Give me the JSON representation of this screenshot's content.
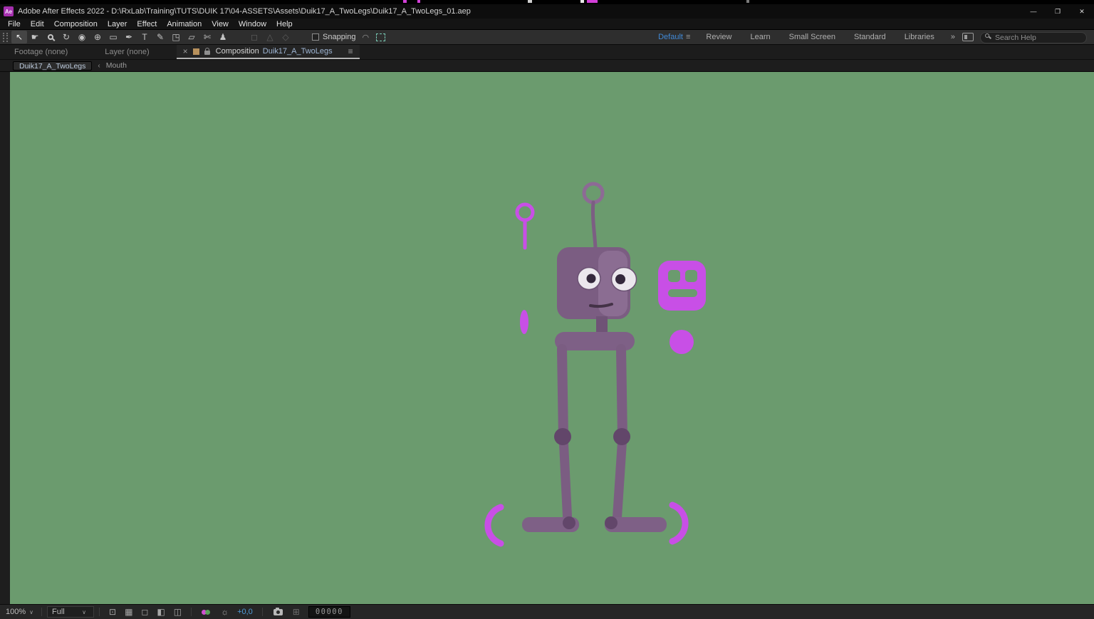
{
  "window": {
    "badge": "Ae",
    "title": "Adobe After Effects 2022 - D:\\RxLab\\Training\\TUTS\\DUIK 17\\04-ASSETS\\Assets\\Duik17_A_TwoLegs\\Duik17_A_TwoLegs_01.aep",
    "minimize": "—",
    "restore": "❐",
    "close": "✕"
  },
  "menu": {
    "items": [
      "File",
      "Edit",
      "Composition",
      "Layer",
      "Effect",
      "Animation",
      "View",
      "Window",
      "Help"
    ]
  },
  "toolbar": {
    "tools": [
      {
        "name": "selection-tool",
        "glyph": "↖"
      },
      {
        "name": "hand-tool",
        "glyph": "☛"
      },
      {
        "name": "zoom-tool",
        "glyph": "css-magnifier"
      },
      {
        "name": "rotation-tool",
        "glyph": "↻"
      },
      {
        "name": "camera-tool",
        "glyph": "◉"
      },
      {
        "name": "pan-behind-tool",
        "glyph": "⊕"
      },
      {
        "name": "shape-tool",
        "glyph": "▭"
      },
      {
        "name": "pen-tool",
        "glyph": "✒"
      },
      {
        "name": "type-tool",
        "glyph": "T"
      },
      {
        "name": "brush-tool",
        "glyph": "✎"
      },
      {
        "name": "clone-stamp-tool",
        "glyph": "◳"
      },
      {
        "name": "eraser-tool",
        "glyph": "▱"
      },
      {
        "name": "roto-brush-tool",
        "glyph": "✄"
      },
      {
        "name": "puppet-tool",
        "glyph": "♟"
      }
    ],
    "disabled_tools": [
      "◻",
      "△",
      "◇"
    ],
    "snapping_label": "Snapping",
    "snap_option_glyph": "◠",
    "workspaces": [
      "Default",
      "Review",
      "Learn",
      "Small Screen",
      "Standard",
      "Libraries"
    ],
    "workspace_menu_glyph": "≡",
    "overflow_glyph": "»",
    "search_placeholder": "Search Help"
  },
  "panel_tabs": {
    "footage_label": "Footage",
    "footage_state": "(none)",
    "layer_label": "Layer",
    "layer_state": "(none)",
    "comp_close": "×",
    "comp_label": "Composition",
    "comp_name": "Duik17_A_TwoLegs",
    "panel_menu": "≡"
  },
  "navigator": {
    "current": "Duik17_A_TwoLegs",
    "arrow": "‹",
    "parent": "Mouth"
  },
  "status_bar": {
    "zoom": "100%",
    "caret": "∨",
    "resolution": "Full",
    "view_layout_glyph": "⊡",
    "transparency_grid_glyph": "▦",
    "mask_visibility_glyph": "◻",
    "region_of_interest_glyph": "◧",
    "pixel_aspect_glyph": "◫",
    "exposure_gear_glyph": "☼",
    "exposure": "+0,0",
    "show_snapshot_glyph": "⊞",
    "timecode": "00000"
  },
  "colors": {
    "viewport_bg": "#6b9b6e",
    "robot_body": "#7b5d82",
    "robot_body_light": "#8b6d92",
    "robot_joint_dark": "#62466a",
    "eye_white": "#ebe7ed",
    "pupil": "#34283c",
    "controller_magenta": "#c84fe6",
    "accent_blue": "#4189d6",
    "comp_name_blue": "#9fb6d4"
  }
}
